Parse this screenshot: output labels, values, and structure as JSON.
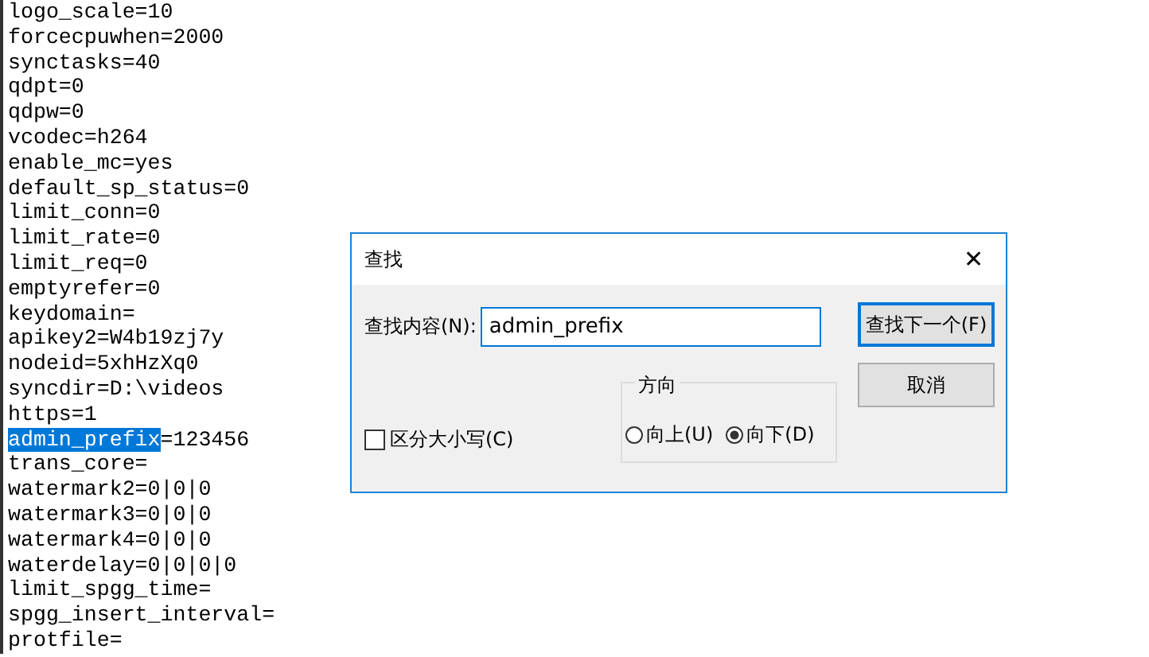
{
  "editor": {
    "lines": [
      {
        "kind": "plain",
        "text": "logo_scale=10"
      },
      {
        "kind": "plain",
        "text": "forcecpuwhen=2000"
      },
      {
        "kind": "plain",
        "text": "synctasks=40"
      },
      {
        "kind": "plain",
        "text": "qdpt=0"
      },
      {
        "kind": "plain",
        "text": "qdpw=0"
      },
      {
        "kind": "plain",
        "text": "vcodec=h264"
      },
      {
        "kind": "plain",
        "text": "enable_mc=yes"
      },
      {
        "kind": "plain",
        "text": "default_sp_status=0"
      },
      {
        "kind": "plain",
        "text": "limit_conn=0"
      },
      {
        "kind": "plain",
        "text": "limit_rate=0"
      },
      {
        "kind": "plain",
        "text": "limit_req=0"
      },
      {
        "kind": "plain",
        "text": "emptyrefer=0"
      },
      {
        "kind": "plain",
        "text": "keydomain="
      },
      {
        "kind": "plain",
        "text": "apikey2=W4b19zj7y"
      },
      {
        "kind": "plain",
        "text": "nodeid=5xhHzXq0"
      },
      {
        "kind": "plain",
        "text": "syncdir=D:\\videos"
      },
      {
        "kind": "plain",
        "text": "https=1"
      },
      {
        "kind": "match",
        "match": "admin_prefix",
        "text": "=123456"
      },
      {
        "kind": "plain",
        "text": "trans_core="
      },
      {
        "kind": "plain",
        "text": "watermark2=0|0|0"
      },
      {
        "kind": "plain",
        "text": "watermark3=0|0|0"
      },
      {
        "kind": "plain",
        "text": "watermark4=0|0|0"
      },
      {
        "kind": "plain",
        "text": "waterdelay=0|0|0|0"
      },
      {
        "kind": "plain",
        "text": "limit_spgg_time="
      },
      {
        "kind": "plain",
        "text": "spgg_insert_interval="
      },
      {
        "kind": "plain",
        "text": "protfile="
      }
    ]
  },
  "find_dialog": {
    "title": "查找",
    "close": "✕",
    "find_label": "查找内容(N):",
    "find_value": "admin_prefix",
    "match_case": {
      "label": "区分大小写(C)",
      "checked": false
    },
    "direction": {
      "title": "方向",
      "options": [
        {
          "label": "向上(U)",
          "selected": false
        },
        {
          "label": "向下(D)",
          "selected": true
        }
      ]
    },
    "buttons": [
      {
        "label": "查找下一个(F)",
        "default": true
      },
      {
        "label": "取消",
        "default": false
      }
    ]
  }
}
